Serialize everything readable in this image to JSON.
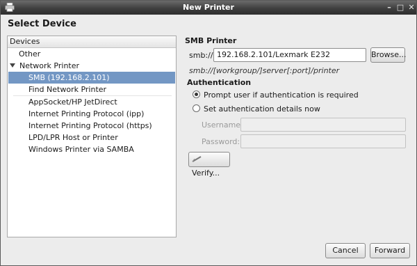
{
  "window": {
    "title": "New Printer"
  },
  "heading": "Select Device",
  "devices": {
    "header": "Devices",
    "other": "Other",
    "network_printer": "Network Printer",
    "selected": "SMB (192.168.2.101)",
    "find_network": "Find Network Printer",
    "items": [
      "AppSocket/HP JetDirect",
      "Internet Printing Protocol (ipp)",
      "Internet Printing Protocol (https)",
      "LPD/LPR Host or Printer",
      "Windows Printer via SAMBA"
    ]
  },
  "smb": {
    "title": "SMB Printer",
    "prefix": "smb://",
    "value": "192.168.2.101/Lexmark E232",
    "browse_label": "Browse...",
    "hint": "smb://[workgroup/]server[:port]/printer"
  },
  "auth": {
    "title": "Authentication",
    "option_prompt": "Prompt user if authentication is required",
    "option_set": "Set authentication details now",
    "username_label": "Username:",
    "password_label": "Password:",
    "username_value": "",
    "password_value": "",
    "verify_label": "Verify...",
    "selected_option": "prompt"
  },
  "footer": {
    "cancel_label": "Cancel",
    "forward_label": "Forward"
  }
}
